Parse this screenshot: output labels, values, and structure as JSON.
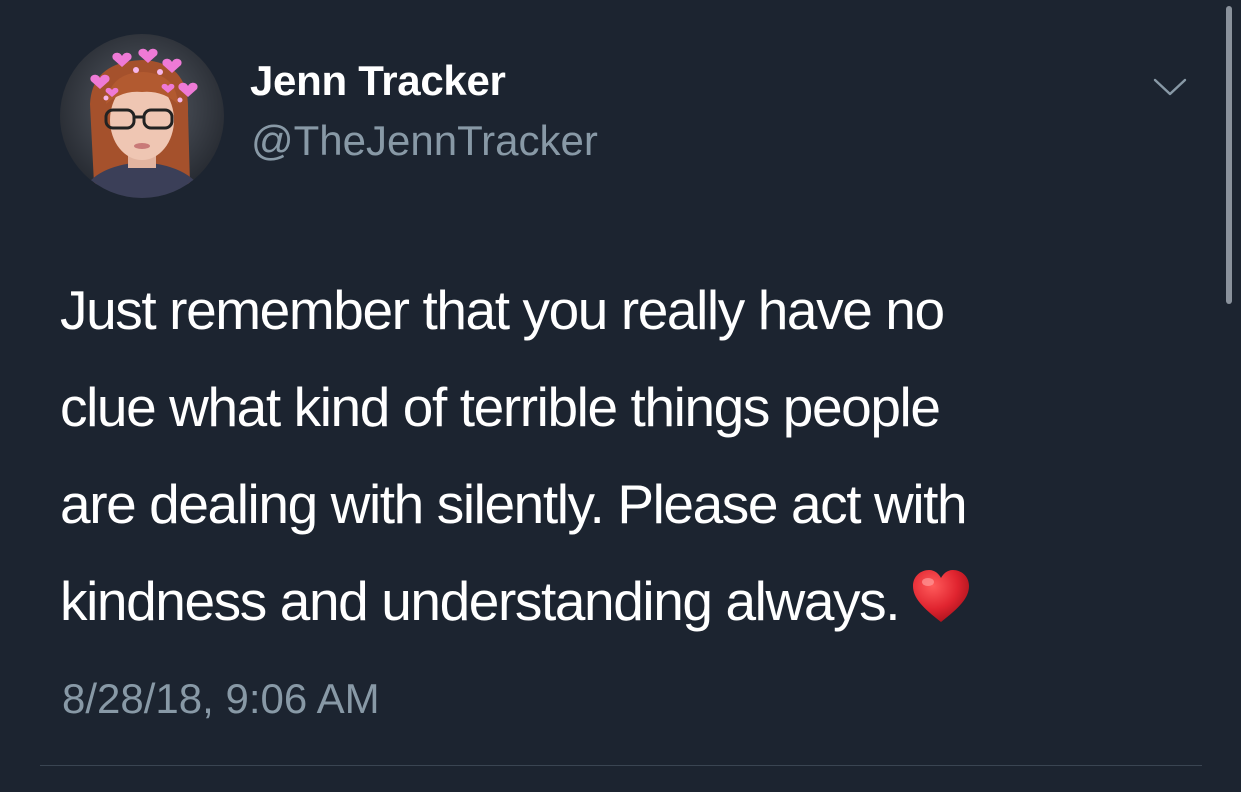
{
  "tweet": {
    "author": {
      "display_name": "Jenn Tracker",
      "handle": "@TheJennTracker"
    },
    "text_lines": [
      "Just remember that you really have no",
      "clue what kind of terrible things people",
      "are dealing with silently. Please act with",
      "kindness and understanding always."
    ],
    "emoji": "red-heart",
    "timestamp": "8/28/18, 9:06 AM"
  },
  "theme": {
    "background": "#1c2430",
    "primary_text": "#ffffff",
    "secondary_text": "#8899a6",
    "heart": "#e0242f"
  },
  "icons": {
    "menu": "chevron-down-icon",
    "emoji": "red-heart-icon"
  }
}
